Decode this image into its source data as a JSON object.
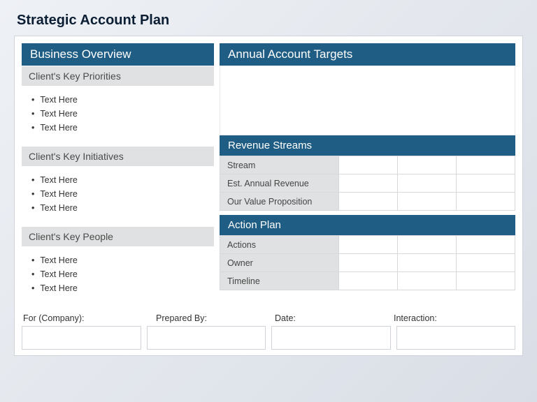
{
  "title": "Strategic Account Plan",
  "left": {
    "header": "Business Overview",
    "sections": [
      {
        "title": "Client's Key Priorities",
        "items": [
          "Text Here",
          "Text Here",
          "Text Here"
        ]
      },
      {
        "title": "Client's Key Initiatives",
        "items": [
          "Text Here",
          "Text Here",
          "Text Here"
        ]
      },
      {
        "title": "Client's Key People",
        "items": [
          "Text Here",
          "Text Here",
          "Text Here"
        ]
      }
    ]
  },
  "right": {
    "targets_header": "Annual Account Targets",
    "revenue": {
      "header": "Revenue Streams",
      "rows": [
        "Stream",
        "Est. Annual Revenue",
        "Our Value Proposition"
      ]
    },
    "action": {
      "header": "Action Plan",
      "rows": [
        "Actions",
        "Owner",
        "Timeline"
      ]
    }
  },
  "meta": {
    "company": "For (Company):",
    "prepared": "Prepared By:",
    "date": "Date:",
    "interaction": "Interaction:"
  }
}
